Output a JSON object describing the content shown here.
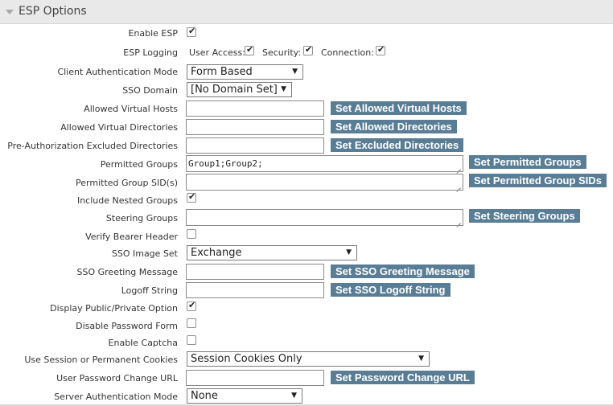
{
  "section": {
    "title": "ESP Options"
  },
  "rows": {
    "enable_esp": {
      "label": "Enable ESP",
      "checked": true
    },
    "esp_logging": {
      "label": "ESP Logging",
      "user_access": {
        "label": "User Access:",
        "checked": true
      },
      "security": {
        "label": "Security:",
        "checked": true
      },
      "connection": {
        "label": "Connection:",
        "checked": true
      }
    },
    "client_auth_mode": {
      "label": "Client Authentication Mode",
      "value": "Form Based"
    },
    "sso_domain": {
      "label": "SSO Domain",
      "value": "[No Domain Set]"
    },
    "allowed_virtual_hosts": {
      "label": "Allowed Virtual Hosts",
      "value": "",
      "button": "Set Allowed Virtual Hosts"
    },
    "allowed_virtual_dirs": {
      "label": "Allowed Virtual Directories",
      "value": "",
      "button": "Set Allowed Directories"
    },
    "preauth_excluded_dirs": {
      "label": "Pre-Authorization Excluded Directories",
      "value": "",
      "button": "Set Excluded Directories"
    },
    "permitted_groups": {
      "label": "Permitted Groups",
      "value": "Group1;Group2;",
      "button": "Set Permitted Groups"
    },
    "permitted_group_sids": {
      "label": "Permitted Group SID(s)",
      "value": "",
      "button": "Set Permitted Group SIDs"
    },
    "include_nested_groups": {
      "label": "Include Nested Groups",
      "checked": true
    },
    "steering_groups": {
      "label": "Steering Groups",
      "value": "",
      "button": "Set Steering Groups"
    },
    "verify_bearer_header": {
      "label": "Verify Bearer Header",
      "checked": false
    },
    "sso_image_set": {
      "label": "SSO Image Set",
      "value": "Exchange"
    },
    "sso_greeting_message": {
      "label": "SSO Greeting Message",
      "value": "",
      "button": "Set SSO Greeting Message"
    },
    "logoff_string": {
      "label": "Logoff String",
      "value": "",
      "button": "Set SSO Logoff String"
    },
    "display_public_private": {
      "label": "Display Public/Private Option",
      "checked": true
    },
    "disable_password_form": {
      "label": "Disable Password Form",
      "checked": false
    },
    "enable_captcha": {
      "label": "Enable Captcha",
      "checked": false
    },
    "session_cookies": {
      "label": "Use Session or Permanent Cookies",
      "value": "Session Cookies Only"
    },
    "password_change_url": {
      "label": "User Password Change URL",
      "value": "",
      "button": "Set Password Change URL"
    },
    "server_auth_mode": {
      "label": "Server Authentication Mode",
      "value": "None"
    }
  },
  "colors": {
    "button_bg": "#5a7d96",
    "header_bg": "#e9e9e9"
  },
  "icons": {
    "collapse": "triangle-down-icon",
    "dropdown": "chevron-down-icon",
    "checkmark": "check-icon"
  }
}
